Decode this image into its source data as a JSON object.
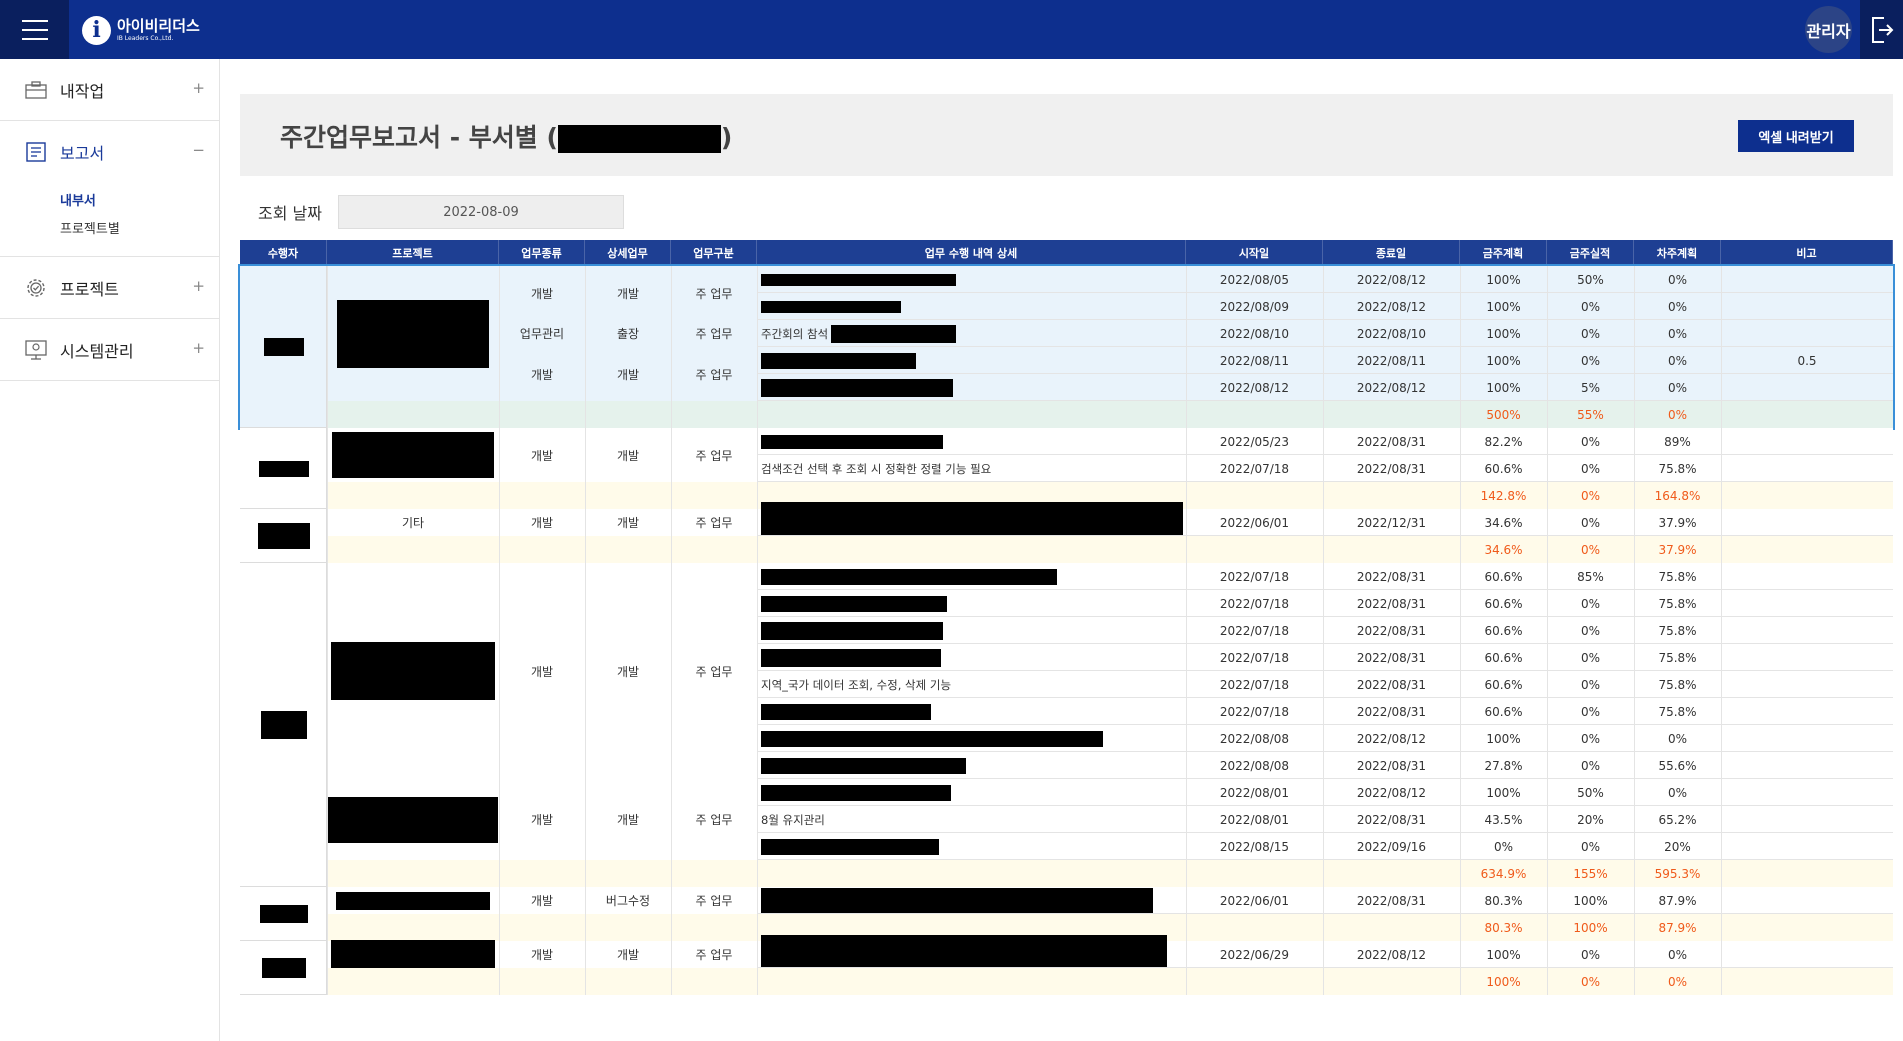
{
  "app": {
    "logo_mark": "i",
    "logo_name": "아이비리더스",
    "logo_sub": "IB Leaders Co.,Ltd.",
    "admin_label": "관리자"
  },
  "sidebar": {
    "items": [
      {
        "label": "내작업",
        "toggle": "+"
      },
      {
        "label": "보고서",
        "toggle": "−",
        "children": [
          {
            "label": "내부서"
          },
          {
            "label": "프로젝트별"
          }
        ]
      },
      {
        "label": "프로젝트",
        "toggle": "+"
      },
      {
        "label": "시스템관리",
        "toggle": "+"
      }
    ]
  },
  "page": {
    "title_prefix": "주간업무보고서 - 부서별 (",
    "title_suffix": ")",
    "excel_button": "엑셀 내려받기",
    "date_label": "조회 날짜",
    "date_value": "2022-08-09"
  },
  "table": {
    "headers": [
      "수행자",
      "프로젝트",
      "업무종류",
      "상세업무",
      "업무구분",
      "업무 수행 내역 상세",
      "시작일",
      "종료일",
      "금주계획",
      "금주실적",
      "차주계획",
      "비고"
    ],
    "groups": [
      {
        "project": "",
        "sub": [
          {
            "type": "개발",
            "detail": "개발",
            "kind": "주 업무",
            "rows": [
              {
                "desc": "",
                "start": "2022/08/05",
                "end": "2022/08/12",
                "plan": "100%",
                "actual": "50%",
                "next": "0%",
                "note": ""
              },
              {
                "desc": "",
                "start": "2022/08/09",
                "end": "2022/08/12",
                "plan": "100%",
                "actual": "0%",
                "next": "0%",
                "note": ""
              }
            ]
          },
          {
            "type": "업무관리",
            "detail": "출장",
            "kind": "주 업무",
            "rows": [
              {
                "desc": "주간회의 참석",
                "start": "2022/08/10",
                "end": "2022/08/10",
                "plan": "100%",
                "actual": "0%",
                "next": "0%",
                "note": ""
              }
            ]
          },
          {
            "type": "개발",
            "detail": "개발",
            "kind": "주 업무",
            "rows": [
              {
                "desc": "",
                "start": "2022/08/11",
                "end": "2022/08/11",
                "plan": "100%",
                "actual": "0%",
                "next": "0%",
                "note": "0.5"
              },
              {
                "desc": "",
                "start": "2022/08/12",
                "end": "2022/08/12",
                "plan": "100%",
                "actual": "5%",
                "next": "0%",
                "note": ""
              }
            ]
          }
        ],
        "total": {
          "plan": "500%",
          "actual": "55%",
          "next": "0%"
        }
      },
      {
        "project": "",
        "sub": [
          {
            "type": "개발",
            "detail": "개발",
            "kind": "주 업무",
            "rows": [
              {
                "desc": "",
                "start": "2022/05/23",
                "end": "2022/08/31",
                "plan": "82.2%",
                "actual": "0%",
                "next": "89%",
                "note": ""
              },
              {
                "desc": "검색조건 선택 후 조회 시 정확한 정렬 기능 필요",
                "start": "2022/07/18",
                "end": "2022/08/31",
                "plan": "60.6%",
                "actual": "0%",
                "next": "75.8%",
                "note": ""
              }
            ]
          }
        ],
        "total": {
          "plan": "142.8%",
          "actual": "0%",
          "next": "164.8%"
        }
      },
      {
        "project": "기타",
        "sub": [
          {
            "type": "개발",
            "detail": "개발",
            "kind": "주 업무",
            "rows": [
              {
                "desc": "",
                "start": "2022/06/01",
                "end": "2022/12/31",
                "plan": "34.6%",
                "actual": "0%",
                "next": "37.9%",
                "note": ""
              }
            ]
          }
        ],
        "total": {
          "plan": "34.6%",
          "actual": "0%",
          "next": "37.9%"
        }
      },
      {
        "project": "",
        "sub": [
          {
            "type": "개발",
            "detail": "개발",
            "kind": "주 업무",
            "rows": [
              {
                "desc": "",
                "start": "2022/07/18",
                "end": "2022/08/31",
                "plan": "60.6%",
                "actual": "85%",
                "next": "75.8%",
                "note": ""
              },
              {
                "desc": "",
                "start": "2022/07/18",
                "end": "2022/08/31",
                "plan": "60.6%",
                "actual": "0%",
                "next": "75.8%",
                "note": ""
              },
              {
                "desc": "",
                "start": "2022/07/18",
                "end": "2022/08/31",
                "plan": "60.6%",
                "actual": "0%",
                "next": "75.8%",
                "note": ""
              },
              {
                "desc": "",
                "start": "2022/07/18",
                "end": "2022/08/31",
                "plan": "60.6%",
                "actual": "0%",
                "next": "75.8%",
                "note": ""
              },
              {
                "desc": "지역_국가 데이터 조회, 수정, 삭제 기능",
                "start": "2022/07/18",
                "end": "2022/08/31",
                "plan": "60.6%",
                "actual": "0%",
                "next": "75.8%",
                "note": ""
              },
              {
                "desc": "",
                "start": "2022/07/18",
                "end": "2022/08/31",
                "plan": "60.6%",
                "actual": "0%",
                "next": "75.8%",
                "note": ""
              },
              {
                "desc": "",
                "start": "2022/08/08",
                "end": "2022/08/12",
                "plan": "100%",
                "actual": "0%",
                "next": "0%",
                "note": ""
              },
              {
                "desc": "",
                "start": "2022/08/08",
                "end": "2022/08/31",
                "plan": "27.8%",
                "actual": "0%",
                "next": "55.6%",
                "note": ""
              }
            ]
          },
          {
            "type": "개발",
            "detail": "개발",
            "kind": "주 업무",
            "rows": [
              {
                "desc": "",
                "start": "2022/08/01",
                "end": "2022/08/12",
                "plan": "100%",
                "actual": "50%",
                "next": "0%",
                "note": ""
              },
              {
                "desc": "8월 유지관리",
                "start": "2022/08/01",
                "end": "2022/08/31",
                "plan": "43.5%",
                "actual": "20%",
                "next": "65.2%",
                "note": ""
              },
              {
                "desc": "",
                "start": "2022/08/15",
                "end": "2022/09/16",
                "plan": "0%",
                "actual": "0%",
                "next": "20%",
                "note": ""
              }
            ]
          }
        ],
        "total": {
          "plan": "634.9%",
          "actual": "155%",
          "next": "595.3%"
        }
      },
      {
        "project": "",
        "sub": [
          {
            "type": "개발",
            "detail": "버그수정",
            "kind": "주 업무",
            "rows": [
              {
                "desc": "",
                "start": "2022/06/01",
                "end": "2022/08/31",
                "plan": "80.3%",
                "actual": "100%",
                "next": "87.9%",
                "note": ""
              }
            ]
          }
        ],
        "total": {
          "plan": "80.3%",
          "actual": "100%",
          "next": "87.9%"
        }
      },
      {
        "project": "",
        "sub": [
          {
            "type": "개발",
            "detail": "개발",
            "kind": "주 업무",
            "rows": [
              {
                "desc": "",
                "start": "2022/06/29",
                "end": "2022/08/12",
                "plan": "100%",
                "actual": "0%",
                "next": "0%",
                "note": ""
              }
            ]
          }
        ],
        "total": {
          "plan": "100%",
          "actual": "0%",
          "next": "0%"
        }
      }
    ]
  },
  "colors": {
    "navy": "#0d2f8e",
    "header": "#1e3f93",
    "total_text": "#f05a1a",
    "total_bg": "#fffbea",
    "selected_bg": "#e9f3fb"
  }
}
